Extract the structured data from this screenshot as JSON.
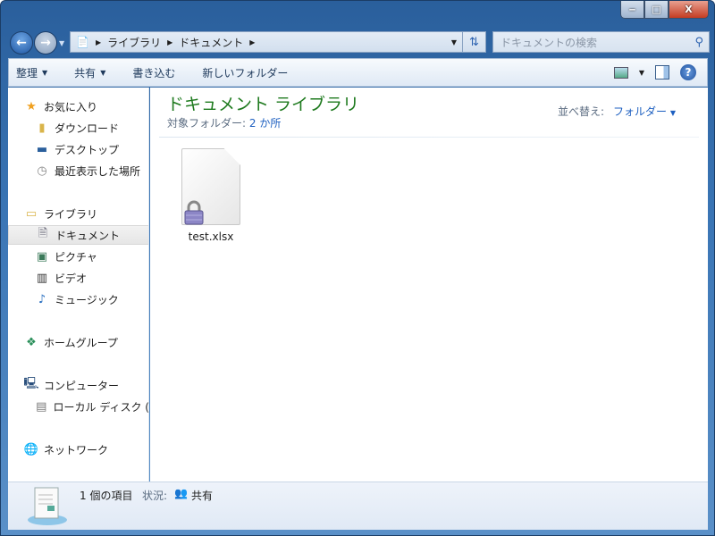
{
  "window": {
    "minimize": "‒",
    "maximize": "□",
    "close": "X"
  },
  "address": {
    "crumbs": [
      "ライブラリ",
      "ドキュメント"
    ]
  },
  "search": {
    "placeholder": "ドキュメントの検索"
  },
  "toolbar": {
    "organize": "整理",
    "share": "共有",
    "burn": "書き込む",
    "new_folder": "新しいフォルダー"
  },
  "sidebar": {
    "favorites": "お気に入り",
    "downloads": "ダウンロード",
    "desktop": "デスクトップ",
    "recent": "最近表示した場所",
    "libraries": "ライブラリ",
    "documents": "ドキュメント",
    "pictures": "ピクチャ",
    "videos": "ビデオ",
    "music": "ミュージック",
    "homegroup": "ホームグループ",
    "computer": "コンピューター",
    "local_disk": "ローカル ディスク (",
    "network": "ネットワーク"
  },
  "content": {
    "title": "ドキュメント ライブラリ",
    "includes_label": "対象フォルダー:",
    "includes_value": "2 か所",
    "sort_label": "並べ替え:",
    "sort_value": "フォルダー"
  },
  "files": [
    {
      "name": "test.xlsx"
    }
  ],
  "status": {
    "count": "1 個の項目",
    "state_label": "状況:",
    "state_value": "共有"
  }
}
